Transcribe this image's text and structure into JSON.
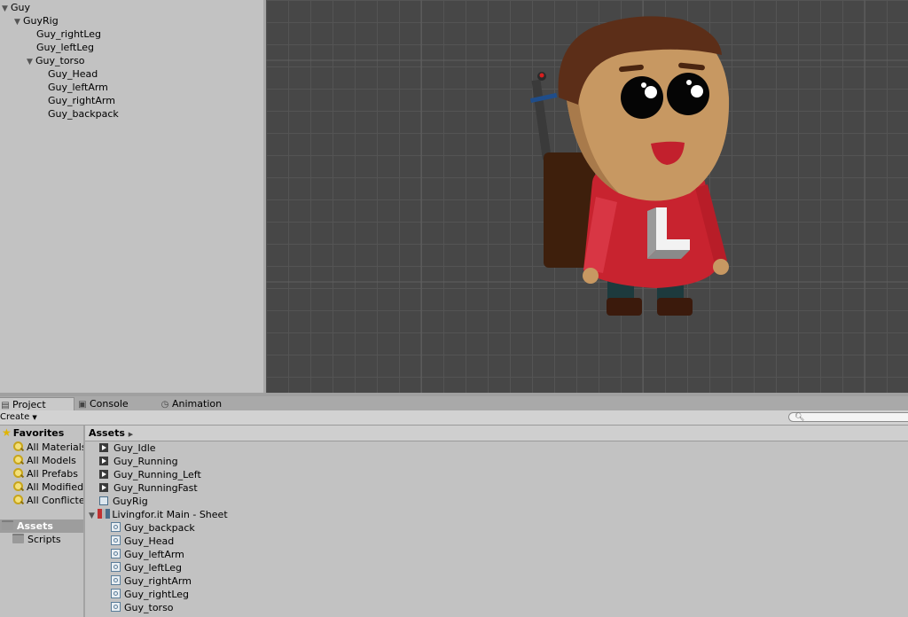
{
  "hierarchy": {
    "items": [
      {
        "label": "Guy",
        "depth": 0,
        "expanded": true
      },
      {
        "label": "GuyRig",
        "depth": 1,
        "expanded": true
      },
      {
        "label": "Guy_rightLeg",
        "depth": 2,
        "expanded": null
      },
      {
        "label": "Guy_leftLeg",
        "depth": 2,
        "expanded": null
      },
      {
        "label": "Guy_torso",
        "depth": 2,
        "expanded": true
      },
      {
        "label": "Guy_Head",
        "depth": 3,
        "expanded": null
      },
      {
        "label": "Guy_leftArm",
        "depth": 3,
        "expanded": null
      },
      {
        "label": "Guy_rightArm",
        "depth": 3,
        "expanded": null
      },
      {
        "label": "Guy_backpack",
        "depth": 3,
        "expanded": null
      }
    ]
  },
  "scene": {
    "background_color": "#474747",
    "character": {
      "hair_color": "#5c2e18",
      "skin_color": "#c79862",
      "shirt_color": "#c8232f",
      "shirt_letter": "L"
    }
  },
  "tabs": [
    {
      "label": "Project",
      "icon": "project-icon",
      "active": true
    },
    {
      "label": "Console",
      "icon": "console-icon",
      "active": false
    },
    {
      "label": "Animation",
      "icon": "animation-icon",
      "active": false
    }
  ],
  "toolbar": {
    "create_label": "Create",
    "search_placeholder": ""
  },
  "left_pane": {
    "favorites_label": "Favorites",
    "favorites": [
      "All Materials",
      "All Models",
      "All Prefabs",
      "All Modified",
      "All Conflicte"
    ],
    "assets_label": "Assets",
    "assets_children": [
      "Scripts"
    ]
  },
  "right_pane": {
    "breadcrumb": "Assets",
    "items": [
      {
        "label": "Guy_Idle",
        "icon": "animation-clip-icon",
        "depth": 0
      },
      {
        "label": "Guy_Running",
        "icon": "animation-clip-icon",
        "depth": 0
      },
      {
        "label": "Guy_Running_Left",
        "icon": "animation-clip-icon",
        "depth": 0
      },
      {
        "label": "Guy_RunningFast",
        "icon": "animation-clip-icon",
        "depth": 0
      },
      {
        "label": "GuyRig",
        "icon": "prefab-icon",
        "depth": 0
      },
      {
        "label": "Livingfor.it Main - Sheet",
        "icon": "sprite-sheet-icon",
        "depth": 0,
        "expanded": true
      },
      {
        "label": "Guy_backpack",
        "icon": "sprite-icon",
        "depth": 1
      },
      {
        "label": "Guy_Head",
        "icon": "sprite-icon",
        "depth": 1
      },
      {
        "label": "Guy_leftArm",
        "icon": "sprite-icon",
        "depth": 1
      },
      {
        "label": "Guy_leftLeg",
        "icon": "sprite-icon",
        "depth": 1
      },
      {
        "label": "Guy_rightArm",
        "icon": "sprite-icon",
        "depth": 1
      },
      {
        "label": "Guy_rightLeg",
        "icon": "sprite-icon",
        "depth": 1
      },
      {
        "label": "Guy_torso",
        "icon": "sprite-icon",
        "depth": 1
      }
    ]
  }
}
